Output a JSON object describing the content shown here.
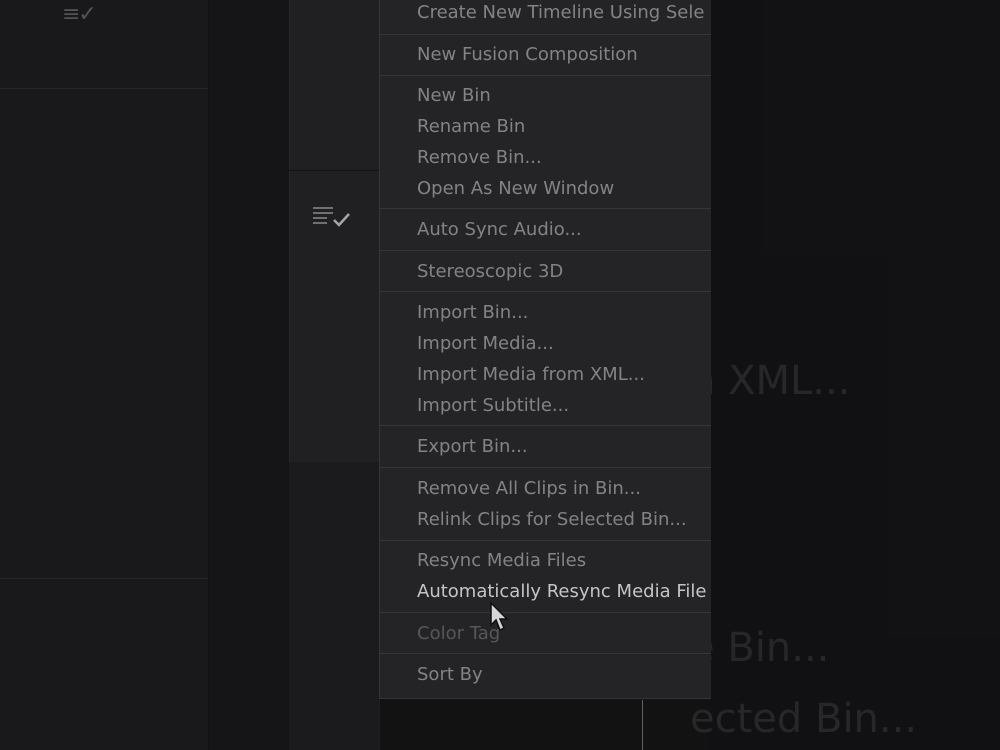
{
  "menu": {
    "items": [
      {
        "label": "Create New Timeline Using Sele",
        "state": "normal"
      },
      {
        "label": "New Fusion Composition",
        "state": "normal"
      },
      {
        "label": "New Bin",
        "state": "normal"
      },
      {
        "label": "Rename Bin",
        "state": "normal"
      },
      {
        "label": "Remove Bin...",
        "state": "normal"
      },
      {
        "label": "Open As New Window",
        "state": "normal"
      },
      {
        "label": "Auto Sync Audio...",
        "state": "normal"
      },
      {
        "label": "Stereoscopic 3D",
        "state": "normal"
      },
      {
        "label": "Import Bin...",
        "state": "normal"
      },
      {
        "label": "Import Media...",
        "state": "normal"
      },
      {
        "label": "Import Media from XML...",
        "state": "normal"
      },
      {
        "label": "Import Subtitle...",
        "state": "normal"
      },
      {
        "label": "Export Bin...",
        "state": "normal"
      },
      {
        "label": "Remove All Clips in Bin...",
        "state": "normal"
      },
      {
        "label": "Relink Clips for Selected Bin...",
        "state": "normal"
      },
      {
        "label": "Resync Media Files",
        "state": "normal"
      },
      {
        "label": "Automatically Resync Media File",
        "state": "hovered"
      },
      {
        "label": "Color Tag",
        "state": "disabled"
      },
      {
        "label": "Sort By",
        "state": "normal"
      }
    ]
  },
  "background": {
    "text_a": "n XML...",
    "text_b": "e Bin...",
    "text_c": "ected Bin..."
  },
  "colors": {
    "menu_bg": "#28282b",
    "item_text": "#8f8f93",
    "item_highlight": "#d6d6d9",
    "item_disabled": "#5f5f63"
  }
}
